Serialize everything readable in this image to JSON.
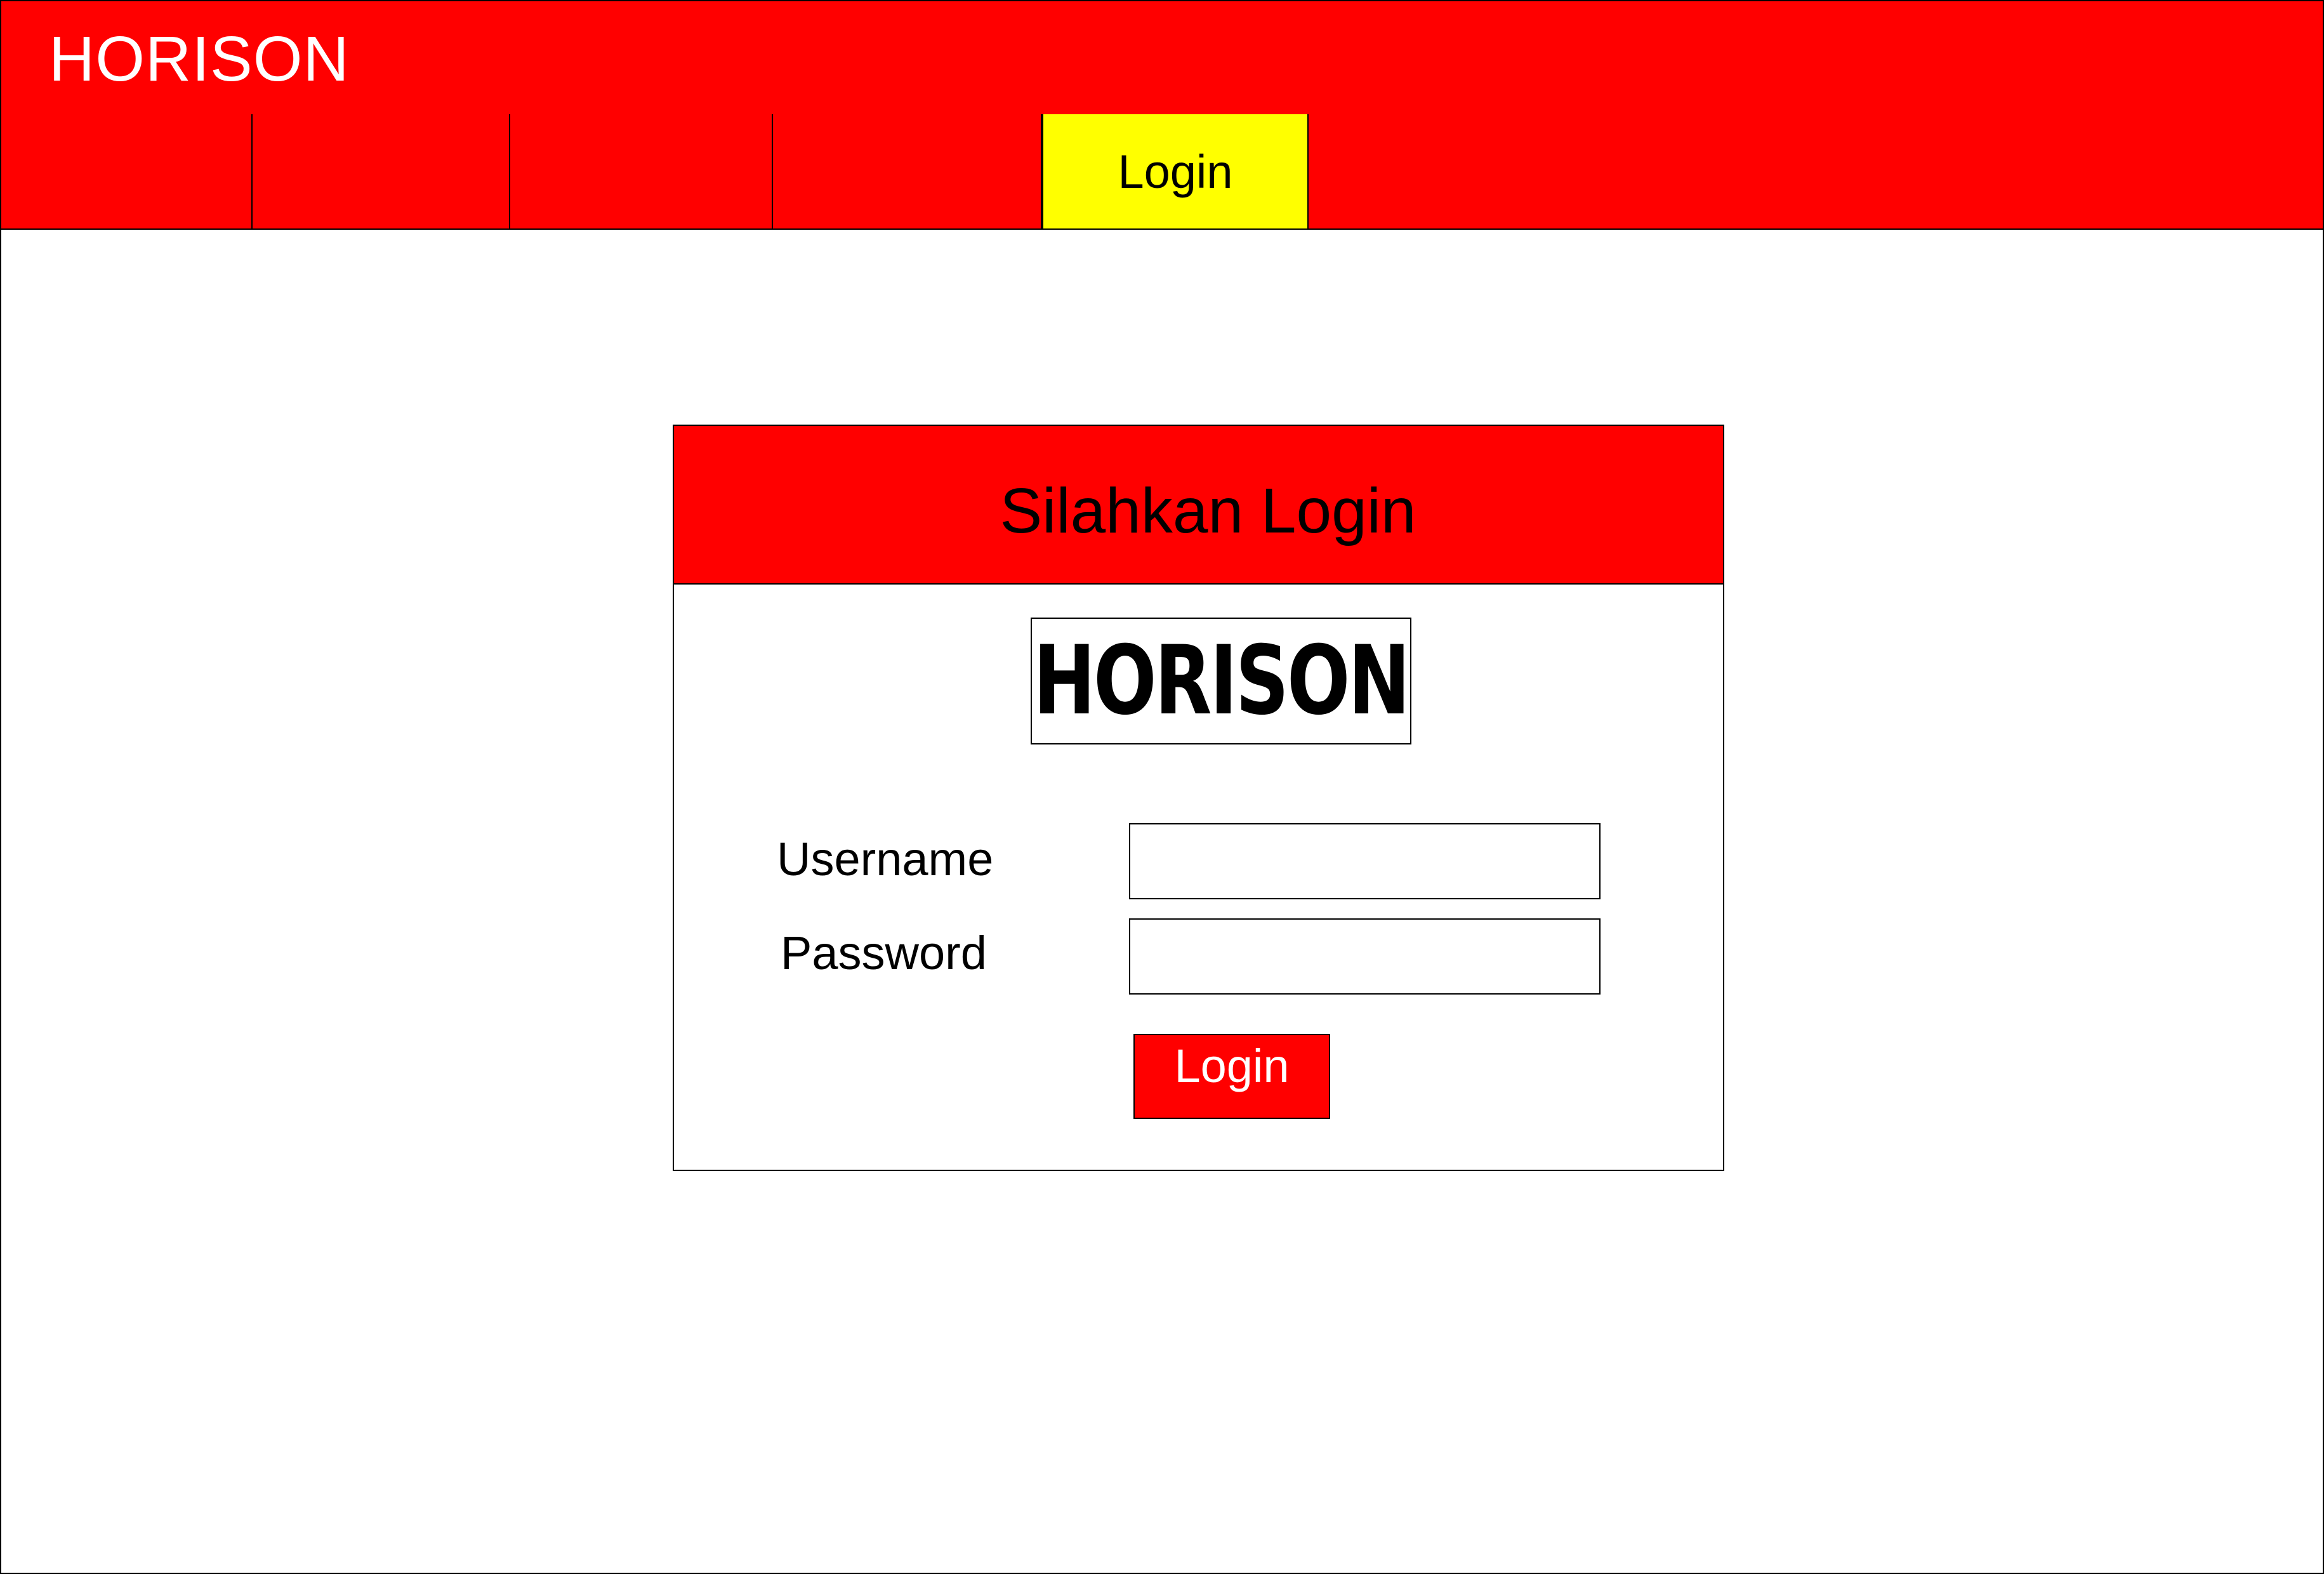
{
  "header": {
    "brand": "HORISON"
  },
  "nav": {
    "tabs": [
      {
        "label": ""
      },
      {
        "label": ""
      },
      {
        "label": ""
      },
      {
        "label": ""
      },
      {
        "label": "Login",
        "active": true
      }
    ]
  },
  "login_card": {
    "title": "Silahkan Login",
    "logo_text": "HORISON",
    "username_label": "Username",
    "username_value": "",
    "password_label": "Password",
    "password_value": "",
    "submit_label": "Login"
  },
  "colors": {
    "primary": "#ff0000",
    "active_tab": "#ffff00",
    "text_on_primary": "#ffffff"
  }
}
